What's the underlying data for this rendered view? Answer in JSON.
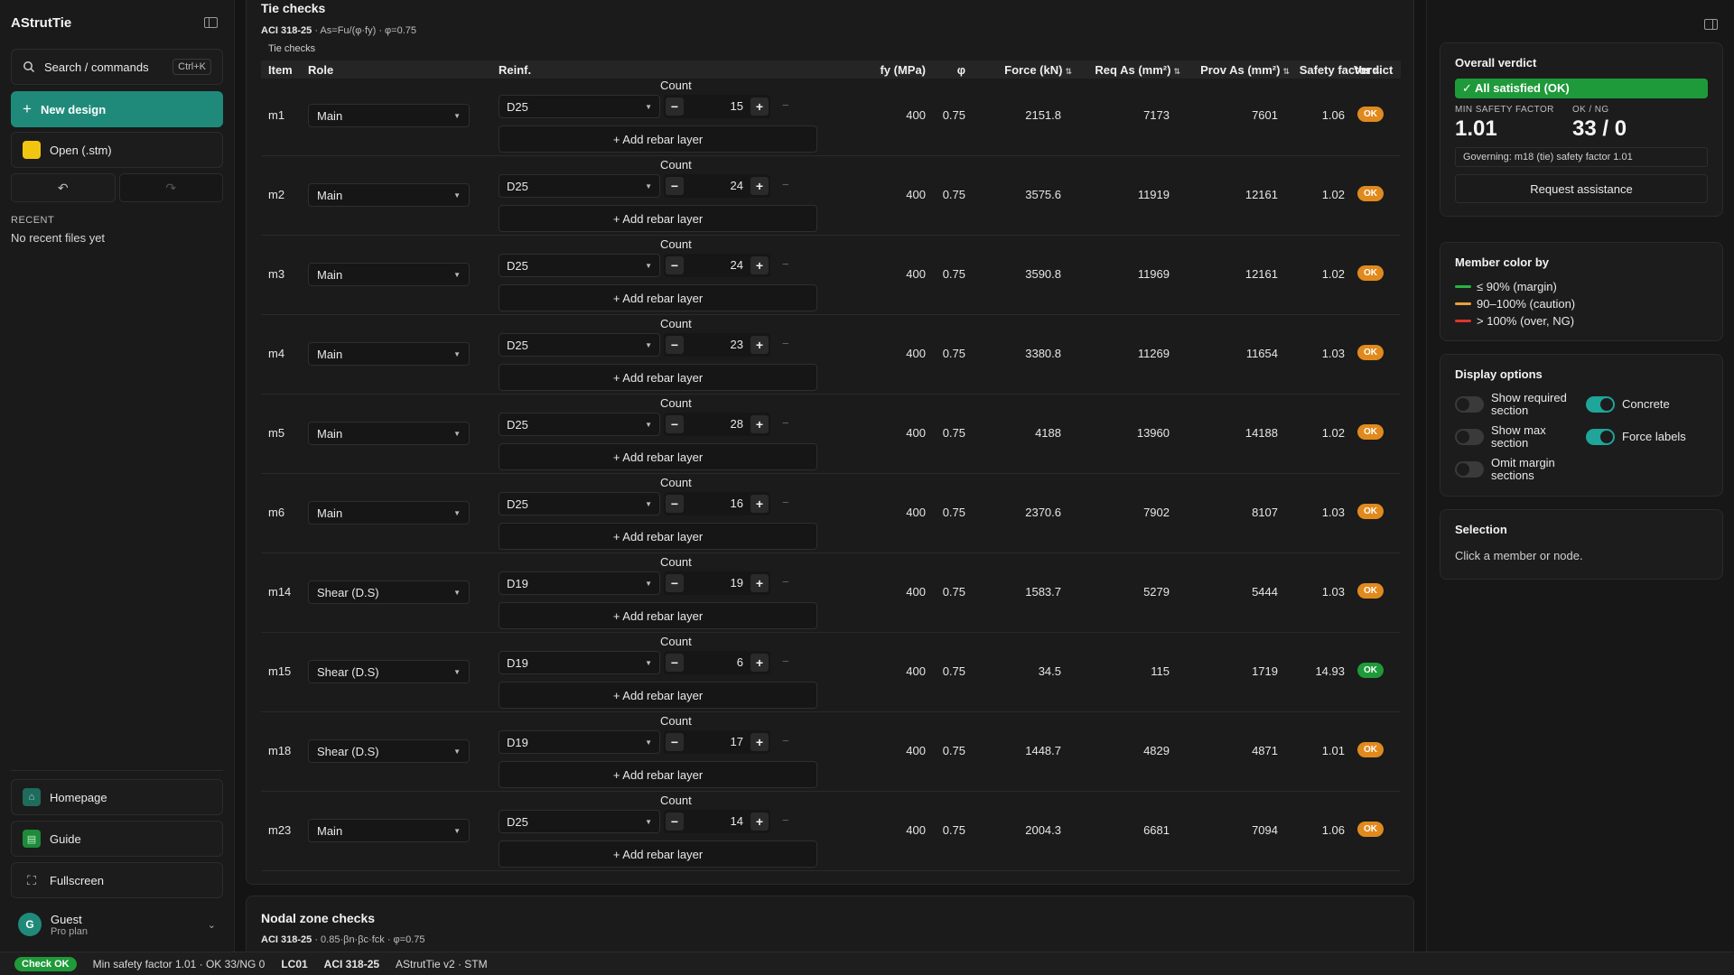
{
  "app": {
    "title": "AStrutTie",
    "search_label": "Search / commands",
    "search_shortcut": "Ctrl+K",
    "new_design": "New design",
    "open_file": "Open (.stm)",
    "recent_label": "RECENT",
    "recent_empty": "No recent files yet",
    "homepage": "Homepage",
    "guide": "Guide",
    "fullscreen": "Fullscreen",
    "user_name": "Guest",
    "user_plan": "Pro plan",
    "user_initial": "G"
  },
  "tie_checks": {
    "title": "Tie checks",
    "code": "ACI 318-25",
    "formula": " · As=Fu/(φ·fy) · φ=0.75",
    "caption": "Tie checks",
    "count_label": "Count",
    "add_layer": "+ Add rebar layer",
    "headers": {
      "item": "Item",
      "role": "Role",
      "reinf": "Reinf.",
      "fy": "fy (MPa)",
      "phi": "φ",
      "force": "Force (kN)",
      "req": "Req As (mm²)",
      "prov": "Prov As (mm²)",
      "sf": "Safety factor",
      "verdict": "Verdict"
    },
    "rows": [
      {
        "item": "m1",
        "role": "Main",
        "bar": "D25",
        "count": "15",
        "fy": "400",
        "phi": "0.75",
        "force": "2151.8",
        "req": "7173",
        "prov": "7601",
        "sf": "1.06",
        "verdict": "OK",
        "color": "#e08a1e"
      },
      {
        "item": "m2",
        "role": "Main",
        "bar": "D25",
        "count": "24",
        "fy": "400",
        "phi": "0.75",
        "force": "3575.6",
        "req": "11919",
        "prov": "12161",
        "sf": "1.02",
        "verdict": "OK",
        "color": "#e08a1e"
      },
      {
        "item": "m3",
        "role": "Main",
        "bar": "D25",
        "count": "24",
        "fy": "400",
        "phi": "0.75",
        "force": "3590.8",
        "req": "11969",
        "prov": "12161",
        "sf": "1.02",
        "verdict": "OK",
        "color": "#e08a1e"
      },
      {
        "item": "m4",
        "role": "Main",
        "bar": "D25",
        "count": "23",
        "fy": "400",
        "phi": "0.75",
        "force": "3380.8",
        "req": "11269",
        "prov": "11654",
        "sf": "1.03",
        "verdict": "OK",
        "color": "#e08a1e"
      },
      {
        "item": "m5",
        "role": "Main",
        "bar": "D25",
        "count": "28",
        "fy": "400",
        "phi": "0.75",
        "force": "4188",
        "req": "13960",
        "prov": "14188",
        "sf": "1.02",
        "verdict": "OK",
        "color": "#e08a1e"
      },
      {
        "item": "m6",
        "role": "Main",
        "bar": "D25",
        "count": "16",
        "fy": "400",
        "phi": "0.75",
        "force": "2370.6",
        "req": "7902",
        "prov": "8107",
        "sf": "1.03",
        "verdict": "OK",
        "color": "#e08a1e"
      },
      {
        "item": "m14",
        "role": "Shear (D.S)",
        "bar": "D19",
        "count": "19",
        "fy": "400",
        "phi": "0.75",
        "force": "1583.7",
        "req": "5279",
        "prov": "5444",
        "sf": "1.03",
        "verdict": "OK",
        "color": "#e08a1e"
      },
      {
        "item": "m15",
        "role": "Shear (D.S)",
        "bar": "D19",
        "count": "6",
        "fy": "400",
        "phi": "0.75",
        "force": "34.5",
        "req": "115",
        "prov": "1719",
        "sf": "14.93",
        "verdict": "OK",
        "color": "#1f9a3a"
      },
      {
        "item": "m18",
        "role": "Shear (D.S)",
        "bar": "D19",
        "count": "17",
        "fy": "400",
        "phi": "0.75",
        "force": "1448.7",
        "req": "4829",
        "prov": "4871",
        "sf": "1.01",
        "verdict": "OK",
        "color": "#e08a1e"
      },
      {
        "item": "m23",
        "role": "Main",
        "bar": "D25",
        "count": "14",
        "fy": "400",
        "phi": "0.75",
        "force": "2004.3",
        "req": "6681",
        "prov": "7094",
        "sf": "1.06",
        "verdict": "OK",
        "color": "#e08a1e"
      }
    ]
  },
  "nodal": {
    "title": "Nodal zone checks",
    "code": "ACI 318-25",
    "formula": " · 0.85·βn·βc·fck · φ=0.75"
  },
  "right": {
    "verdict_title": "Overall verdict",
    "verdict_text": "✓ All satisfied (OK)",
    "min_sf_label": "MIN SAFETY FACTOR",
    "min_sf": "1.01",
    "okng_label": "OK / NG",
    "okng": "33 / 0",
    "governing": "Governing: m18 (tie) safety factor 1.01",
    "assist": "Request assistance",
    "color_title": "Member color by",
    "legend": [
      {
        "label": "≤ 90% (margin)",
        "color": "#27b43e"
      },
      {
        "label": "90–100% (caution)",
        "color": "#e8a13a"
      },
      {
        "label": "> 100% (over, NG)",
        "color": "#e0342c"
      }
    ],
    "display_title": "Display options",
    "options": {
      "show_required": "Show required section",
      "concrete": "Concrete",
      "show_max": "Show max section",
      "force_labels": "Force labels",
      "omit_margin": "Omit margin sections"
    },
    "selection_title": "Selection",
    "selection_hint": "Click a member or node."
  },
  "status": {
    "badge": "Check OK",
    "summary": "Min safety factor 1.01 · OK 33/NG 0",
    "load_case": "LC01",
    "code": "ACI 318-25",
    "version": "AStrutTie v2 · STM"
  }
}
